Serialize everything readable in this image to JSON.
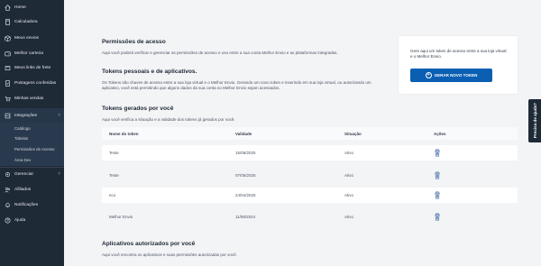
{
  "sidebar": {
    "items": [
      {
        "label": "Home",
        "icon": "home-icon"
      },
      {
        "label": "Calculadora",
        "icon": "calculator-icon"
      },
      {
        "label": "Meus envios",
        "icon": "box-icon"
      },
      {
        "label": "Melhor carteira",
        "icon": "wallet-icon"
      },
      {
        "label": "Meus links de frete",
        "icon": "link-icon"
      },
      {
        "label": "Postagens conferidas",
        "icon": "checklist-icon"
      },
      {
        "label": "Minhas vendas",
        "icon": "cart-icon"
      },
      {
        "label": "Integrações",
        "icon": "integration-icon"
      }
    ],
    "submenu": [
      "Catálogo",
      "Tabelas",
      "Permissões de Acesso",
      "Área Dev"
    ],
    "bottom_items": [
      {
        "label": "Gerenciar",
        "icon": "gear-icon"
      },
      {
        "label": "Afiliados",
        "icon": "affiliates-icon"
      },
      {
        "label": "Notificações",
        "icon": "bell-icon"
      },
      {
        "label": "Ajuda",
        "icon": "help-icon"
      }
    ]
  },
  "permissions": {
    "title": "Permissões de acesso",
    "text": "Aqui você poderá verificar e gerenciar as permissões de acesso e uso entre a sua conta Melhor Envio e as plataformas integradas."
  },
  "tokens_section": {
    "title": "Tokens pessoais e de aplicativos.",
    "text": "Os Tokens são chaves de acesso entre a sua loja virtual e o Melhor Envio. Gerando um novo token e inserindo em sua loja virtual, ou autorizando um aplicativo, você está permitindo que alguns dados da sua conta no Melhor Envio sejam acessados."
  },
  "token_card": {
    "text": "Gere aqui um token de acesso entre a sua loja virtual e o Melhor Envio.",
    "button_label": "GERAR NOVO TOKEN"
  },
  "generated": {
    "title": "Tokens gerados por você",
    "text": "Aqui você verifica a situação e a validade dos tokens já gerados por você.",
    "columns": [
      "Nome do token",
      "Validade",
      "Situação",
      "Ações"
    ],
    "rows": [
      {
        "name": "Teste",
        "validity": "15/05/2025",
        "status": "Ativo"
      },
      {
        "name": "Teste",
        "validity": "07/05/2025",
        "status": "Ativo"
      },
      {
        "name": "eco",
        "validity": "24/04/2025",
        "status": "Ativo"
      },
      {
        "name": "Melhor Envio",
        "validity": "11/08/2024",
        "status": "Ativo"
      }
    ]
  },
  "authorized": {
    "title": "Aplicativos autorizados por você",
    "text": "Aqui você encontra os aplicativos e suas permissões autorizadas por você."
  },
  "help_tab": {
    "label": "Precisa de ajuda?"
  },
  "colors": {
    "sidebar": "#1f2a37",
    "primary_button": "#0b5fb3",
    "trash": "#4a6fa5"
  }
}
